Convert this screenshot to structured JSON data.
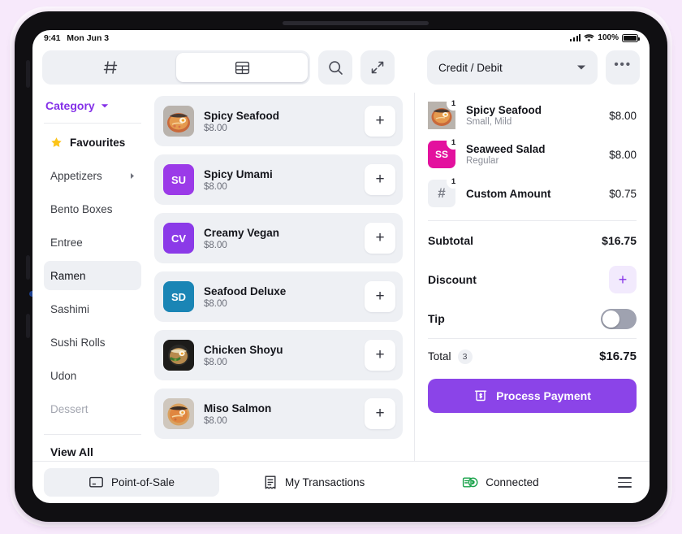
{
  "status_bar": {
    "time": "9:41",
    "date": "Mon Jun 3",
    "battery_percent": "100%",
    "wifi_icon": "wifi-icon",
    "cellular_icon": "cellular-bars-icon",
    "battery_icon": "battery-full-icon"
  },
  "toolbar": {
    "segmented": [
      {
        "icon": "hash-keypad-icon",
        "label": "#",
        "selected": false
      },
      {
        "icon": "grid-table-icon",
        "label": "",
        "selected": true
      }
    ],
    "search_icon": "search-icon",
    "expand_icon": "expand-arrows-icon",
    "payment_method": "Credit / Debit",
    "payment_caret_icon": "chevron-down-icon",
    "more_icon": "more-horizontal-icon",
    "more_label": "•••"
  },
  "sidebar": {
    "header": "Category",
    "header_caret_icon": "chevron-down-icon",
    "items": [
      {
        "label": "Favourites",
        "icon": "star-icon",
        "state": "favourite"
      },
      {
        "label": "Appetizers",
        "state": "normal",
        "chevron": "chevron-right-icon"
      },
      {
        "label": "Bento Boxes",
        "state": "normal"
      },
      {
        "label": "Entree",
        "state": "normal"
      },
      {
        "label": "Ramen",
        "state": "selected"
      },
      {
        "label": "Sashimi",
        "state": "normal"
      },
      {
        "label": "Sushi Rolls",
        "state": "normal"
      },
      {
        "label": "Udon",
        "state": "normal"
      },
      {
        "label": "Dessert",
        "state": "muted"
      }
    ],
    "view_all": "View All"
  },
  "products": [
    {
      "name": "Spicy Seafood",
      "price": "$8.00",
      "thumb_type": "photo",
      "photo": "ramen-seafood",
      "add_label": "+"
    },
    {
      "name": "Spicy Umami",
      "price": "$8.00",
      "thumb_type": "initials",
      "initials": "SU",
      "color": "#9b3ae8",
      "add_label": "+"
    },
    {
      "name": "Creamy Vegan",
      "price": "$8.00",
      "thumb_type": "initials",
      "initials": "CV",
      "color": "#8b3ae8",
      "add_label": "+"
    },
    {
      "name": "Seafood Deluxe",
      "price": "$8.00",
      "thumb_type": "initials",
      "initials": "SD",
      "color": "#1a85b5",
      "add_label": "+"
    },
    {
      "name": "Chicken Shoyu",
      "price": "$8.00",
      "thumb_type": "photo",
      "photo": "ramen-shoyu",
      "add_label": "+"
    },
    {
      "name": "Miso Salmon",
      "price": "$8.00",
      "thumb_type": "photo",
      "photo": "ramen-miso",
      "add_label": "+"
    }
  ],
  "cart": {
    "items": [
      {
        "name": "Spicy Seafood",
        "options": "Small, Mild",
        "price": "$8.00",
        "qty": "1",
        "thumb_type": "photo",
        "photo": "ramen-seafood"
      },
      {
        "name": "Seaweed Salad",
        "options": "Regular",
        "price": "$8.00",
        "qty": "1",
        "thumb_type": "initials",
        "initials": "SS",
        "color": "#e3119e"
      },
      {
        "name": "Custom Amount",
        "options": "",
        "price": "$0.75",
        "qty": "1",
        "thumb_type": "hash",
        "initials": "#",
        "color": "#eef0f4"
      }
    ],
    "subtotal_label": "Subtotal",
    "subtotal_value": "$16.75",
    "discount_label": "Discount",
    "discount_add_label": "+",
    "discount_add_icon": "plus-icon",
    "tip_label": "Tip",
    "tip_enabled": false,
    "total_label": "Total",
    "total_count": "3",
    "total_value": "$16.75",
    "process_button_label": "Process Payment",
    "process_button_icon": "card-reader-icon"
  },
  "bottom_nav": {
    "items": [
      {
        "label": "Point-of-Sale",
        "icon": "pos-terminal-icon",
        "active": true
      },
      {
        "label": "My Transactions",
        "icon": "receipt-icon",
        "active": false
      },
      {
        "label": "Connected",
        "icon": "card-reader-bluetooth-icon",
        "active": false
      }
    ],
    "menu_icon": "hamburger-menu-icon"
  },
  "theme": {
    "accent": "#8430e8",
    "process_button": "#8b44e8",
    "panel_bg": "#eef0f4",
    "page_bg": "#f7e9fb",
    "connected_green": "#19a24a"
  }
}
